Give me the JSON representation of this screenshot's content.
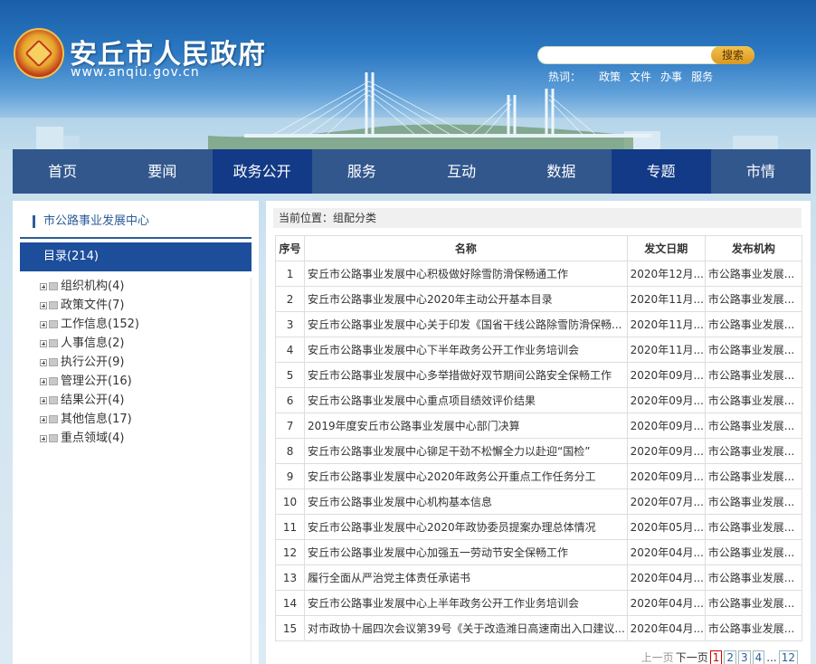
{
  "header": {
    "site_title": "安丘市人民政府",
    "site_url": "www.anqiu.gov.cn",
    "search_placeholder": "",
    "search_button": "搜索",
    "hotwords_label": "热词：",
    "hotwords": [
      "政策",
      "文件",
      "办事",
      "服务"
    ]
  },
  "nav": {
    "items": [
      {
        "label": "首页"
      },
      {
        "label": "要闻"
      },
      {
        "label": "政务公开"
      },
      {
        "label": "服务"
      },
      {
        "label": "互动"
      },
      {
        "label": "数据"
      },
      {
        "label": "专题"
      },
      {
        "label": "市情"
      }
    ],
    "active_index": 2
  },
  "sidebar": {
    "title": "市公路事业发展中心",
    "catalog": "目录(214)",
    "tree": [
      {
        "label": "组织机构(4)"
      },
      {
        "label": "政策文件(7)"
      },
      {
        "label": "工作信息(152)"
      },
      {
        "label": "人事信息(2)"
      },
      {
        "label": "执行公开(9)"
      },
      {
        "label": "管理公开(16)"
      },
      {
        "label": "结果公开(4)"
      },
      {
        "label": "其他信息(17)"
      },
      {
        "label": "重点领域(4)"
      }
    ]
  },
  "main": {
    "breadcrumb": "当前位置：组配分类",
    "headers": {
      "seq": "序号",
      "name": "名称",
      "date": "发文日期",
      "org": "发布机构"
    },
    "rows": [
      {
        "seq": "1",
        "name": "安丘市公路事业发展中心积极做好除雪防滑保畅通工作",
        "date": "2020年12月...",
        "org": "市公路事业发展..."
      },
      {
        "seq": "2",
        "name": "安丘市公路事业发展中心2020年主动公开基本目录",
        "date": "2020年11月...",
        "org": "市公路事业发展..."
      },
      {
        "seq": "3",
        "name": "安丘市公路事业发展中心关于印发《国省干线公路除雪防滑保畅...",
        "date": "2020年11月...",
        "org": "市公路事业发展..."
      },
      {
        "seq": "4",
        "name": "安丘市公路事业发展中心下半年政务公开工作业务培训会",
        "date": "2020年11月...",
        "org": "市公路事业发展..."
      },
      {
        "seq": "5",
        "name": "安丘市公路事业发展中心多举措做好双节期间公路安全保畅工作",
        "date": "2020年09月...",
        "org": "市公路事业发展..."
      },
      {
        "seq": "6",
        "name": "安丘市公路事业发展中心重点项目绩效评价结果",
        "date": "2020年09月...",
        "org": "市公路事业发展..."
      },
      {
        "seq": "7",
        "name": "2019年度安丘市公路事业发展中心部门决算",
        "date": "2020年09月...",
        "org": "市公路事业发展..."
      },
      {
        "seq": "8",
        "name": "安丘市公路事业发展中心铆足干劲不松懈全力以赴迎“国检”",
        "date": "2020年09月...",
        "org": "市公路事业发展..."
      },
      {
        "seq": "9",
        "name": "安丘市公路事业发展中心2020年政务公开重点工作任务分工",
        "date": "2020年09月...",
        "org": "市公路事业发展..."
      },
      {
        "seq": "10",
        "name": "安丘市公路事业发展中心机构基本信息",
        "date": "2020年07月...",
        "org": "市公路事业发展..."
      },
      {
        "seq": "11",
        "name": "安丘市公路事业发展中心2020年政协委员提案办理总体情况",
        "date": "2020年05月...",
        "org": "市公路事业发展..."
      },
      {
        "seq": "12",
        "name": "安丘市公路事业发展中心加强五一劳动节安全保畅工作",
        "date": "2020年04月...",
        "org": "市公路事业发展..."
      },
      {
        "seq": "13",
        "name": "履行全面从严治党主体责任承诺书",
        "date": "2020年04月...",
        "org": "市公路事业发展..."
      },
      {
        "seq": "14",
        "name": "安丘市公路事业发展中心上半年政务公开工作业务培训会",
        "date": "2020年04月...",
        "org": "市公路事业发展..."
      },
      {
        "seq": "15",
        "name": "对市政协十届四次会议第39号《关于改造潍日高速南出入口建议...",
        "date": "2020年04月...",
        "org": "市公路事业发展..."
      }
    ],
    "pager": {
      "prev": "上一页",
      "next": "下一页",
      "pages": [
        "1",
        "2",
        "3",
        "4"
      ],
      "ellipsis": "...",
      "last": "12",
      "current": "1"
    }
  },
  "colors": {
    "nav_bg": "#32578d",
    "nav_active": "#133a86",
    "catalog_bg": "#1c4e9b",
    "accent": "#2d5c9a"
  },
  "icons": {
    "tree_expand": "plus-box-icon",
    "tree_folder": "folder-icon",
    "emblem": "national-emblem-icon"
  }
}
